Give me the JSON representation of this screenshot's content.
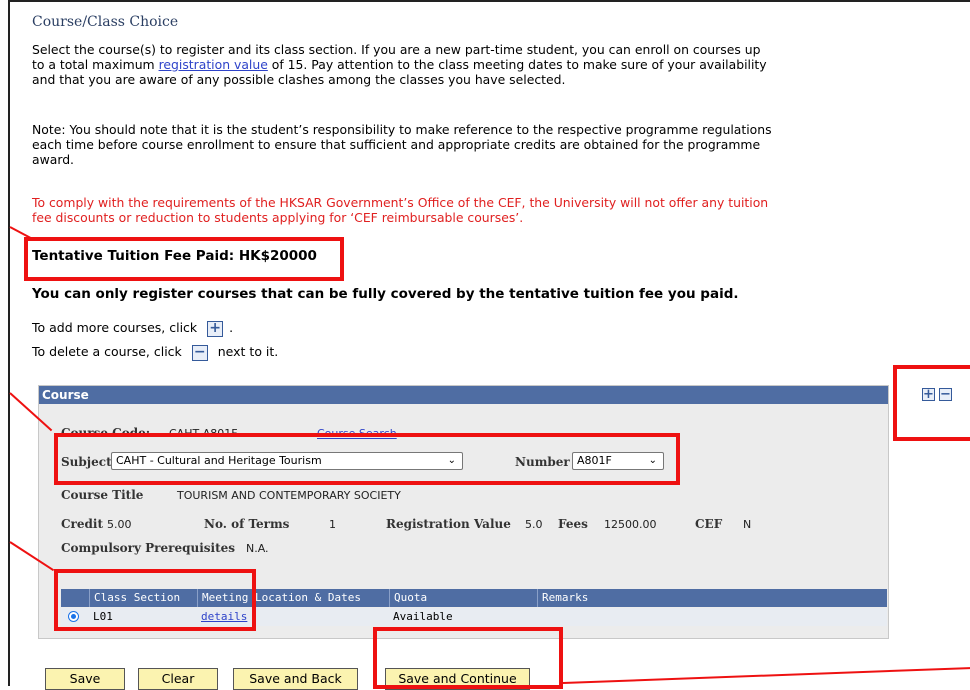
{
  "page": {
    "title": "Course/Class Choice",
    "intro_before_link": "Select the course(s) to register and its class section. If you are a new part-time student, you can enroll on courses up to a total maximum ",
    "intro_link": "registration value",
    "intro_after_link": " of 15. Pay attention to the class meeting dates to make sure of your availability and that you are aware of any possible clashes among the classes you have selected.",
    "note": "Note: You should note that it is the student’s responsibility to make reference to the respective programme regulations each time before course enrollment to ensure that sufficient and appropriate credits are obtained for the programme award.",
    "cef_notice": "To comply with the requirements of the HKSAR Government’s Office of the CEF, the University will not offer any tuition fee discounts or reduction to students applying for ‘CEF reimbursable courses’.",
    "tuition_paid": "Tentative Tuition Fee Paid: HK$20000",
    "covered_notice": "You can only register courses that can be fully covered by the tentative tuition fee you paid.",
    "add_hint_before": "To add more courses, click",
    "add_hint_after": ".",
    "delete_hint_before": "To delete a course, click",
    "delete_hint_after": "next to it."
  },
  "course_panel": {
    "header": "Course",
    "course_code_label": "Course Code:",
    "course_code_value": "CAHT  A801F",
    "course_search_link": "Course Search",
    "subject_label": "Subject",
    "subject_selected": "CAHT - Cultural and Heritage Tourism",
    "number_label": "Number",
    "number_selected": "A801F",
    "course_title_label": "Course Title",
    "course_title_value": "TOURISM AND CONTEMPORARY SOCIETY",
    "credit_label": "Credit",
    "credit_value": "5.00",
    "terms_label": "No. of Terms",
    "terms_value": "1",
    "reg_value_label": "Registration Value",
    "reg_value": "5.0",
    "fees_label": "Fees",
    "fees_value": "12500.00",
    "cef_label": "CEF",
    "cef_value": "N",
    "prereq_label": "Compulsory Prerequisites",
    "prereq_value": "N.A."
  },
  "class_table": {
    "columns": [
      "Class Section",
      "Meeting Location & Dates",
      "Quota",
      "Remarks"
    ],
    "rows": [
      {
        "section": "L01",
        "meeting": "details",
        "quota": "Available",
        "remarks": ""
      }
    ]
  },
  "icons": {
    "add": "+",
    "remove": "−",
    "chevron": "⌄"
  },
  "buttons": {
    "save": "Save",
    "clear": "Clear",
    "save_back": "Save and Back",
    "save_continue": "Save and Continue"
  },
  "colors": {
    "highlight": "#ee1111",
    "header_blue": "#4f6da3",
    "button_yellow": "#fbf3b0",
    "notice_red": "#e02020"
  }
}
